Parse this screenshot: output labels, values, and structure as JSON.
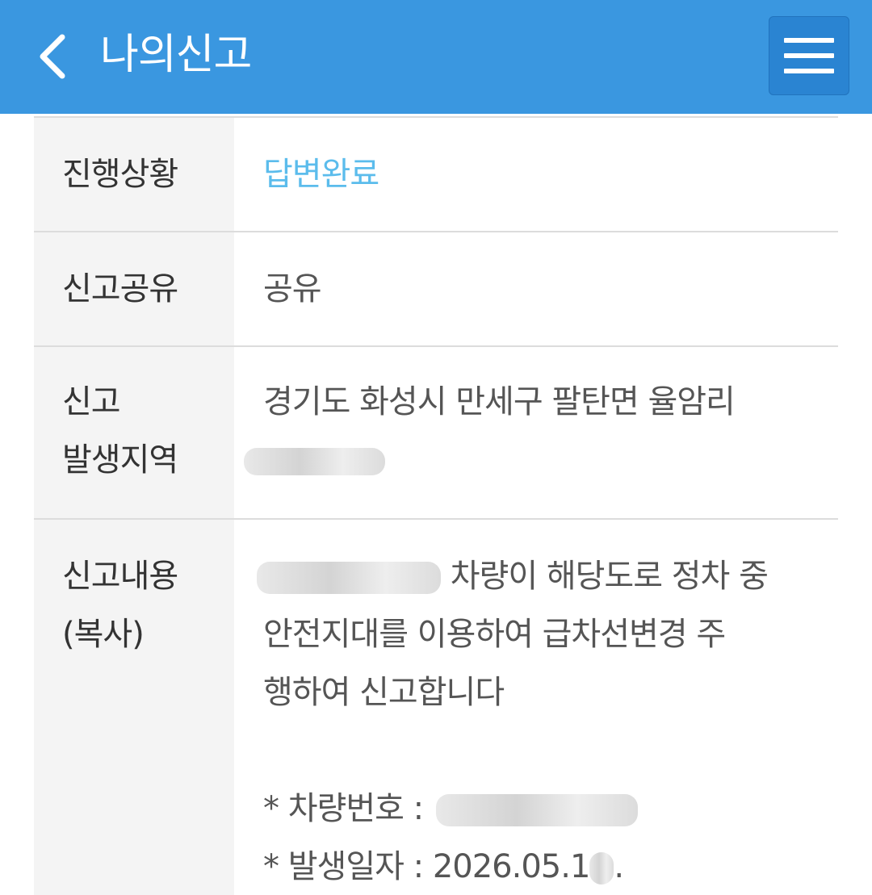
{
  "header": {
    "back_icon": "chevron-left-icon",
    "title": "나의신고",
    "menu_icon": "hamburger-menu-icon",
    "background_color": "#3a97e0"
  },
  "rows": {
    "status": {
      "label": "진행상황",
      "value": "답변완료",
      "value_color": "#5bbcec"
    },
    "share": {
      "label": "신고공유",
      "value": "공유"
    },
    "location": {
      "label_line1": "신고",
      "label_line2": "발생지역",
      "value": "경기도 화성시 만세구 팔탄면 율암리"
    },
    "content": {
      "label_line1": "신고내용",
      "label_line2": "(복사)",
      "line1_suffix": "차량이 해당도로 정차 중",
      "line2": "안전지대를 이용하여 급차선변경 주",
      "line3": "행하여 신고합니다",
      "vehicle_label": "* 차량번호 :",
      "date_label": "* 발생일자 :",
      "date_value": "2026.05.1"
    }
  }
}
